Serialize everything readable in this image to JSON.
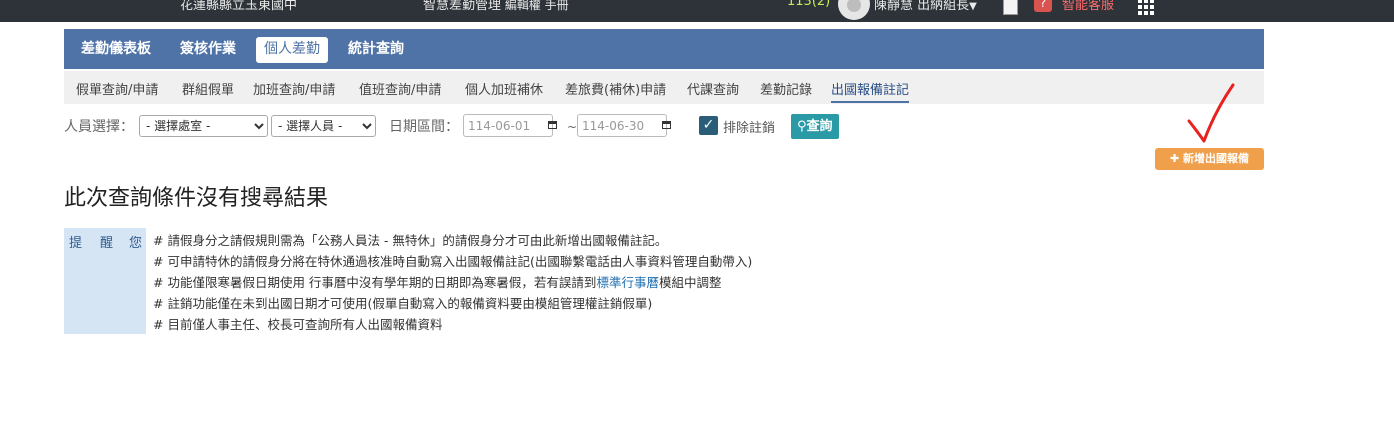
{
  "topbar": {
    "school": "花蓮縣縣立玉東國中",
    "system_title": "智慧差勤管理",
    "system_sub": " 編輯權 手冊",
    "notification_count": "113(2)",
    "user_label": "陳靜慧 出納組長",
    "help_label": "智能客服"
  },
  "main_nav": {
    "items": [
      "差勤儀表板",
      "簽核作業",
      "個人差勤",
      "統計查詢"
    ],
    "active_index": 2
  },
  "sub_nav": {
    "tabs": [
      "假單查詢/申請",
      "群組假單",
      "加班查詢/申請",
      "值班查詢/申請",
      "個人加班補休",
      "差旅費(補休)申請",
      "代課查詢",
      "差勤記錄",
      "出國報備註記"
    ],
    "active_index": 8
  },
  "filter": {
    "person_label": "人員選擇：",
    "department_selected": "- 選擇處室 -",
    "person_selected": "- 選擇人員 -",
    "date_label": "日期區間：",
    "date_from": "114-06-01",
    "date_to": "114-06-30",
    "date_sep": "~",
    "exclude_cancelled_label": "排除註銷",
    "exclude_cancelled_checked": true,
    "query_label": "查詢",
    "add_button_label": "新增出國報備"
  },
  "result": {
    "empty_message": "此次查詢條件沒有搜尋結果"
  },
  "notice": {
    "label_chars": [
      "提",
      "醒",
      "您"
    ],
    "lines": [
      "# 請假身分之請假規則需為「公務人員法 - 無特休」的請假身分才可由此新增出國報備註記。",
      "# 可申請特休的請假身分將在特休通過核准時自動寫入出國報備註記(出國聯繫電話由人事資料管理自動帶入)",
      "# 功能僅限寒暑假日期使用 行事曆中沒有學年期的日期即為寒暑假，若有誤請到",
      "# 註銷功能僅在未到出國日期才可使用(假單自動寫入的報備資料要由模組管理權註銷假單)",
      "# 目前僅人事主任、校長可查詢所有人出國報備資料"
    ],
    "line3_link": "標準行事曆",
    "line3_suffix": "模組中調整"
  },
  "colors": {
    "topbar": "#2d3338",
    "main_nav": "#4f73a7",
    "query_button": "#2b9aa7",
    "add_button": "#f0a04a",
    "annotation_check": "#e8221e"
  }
}
